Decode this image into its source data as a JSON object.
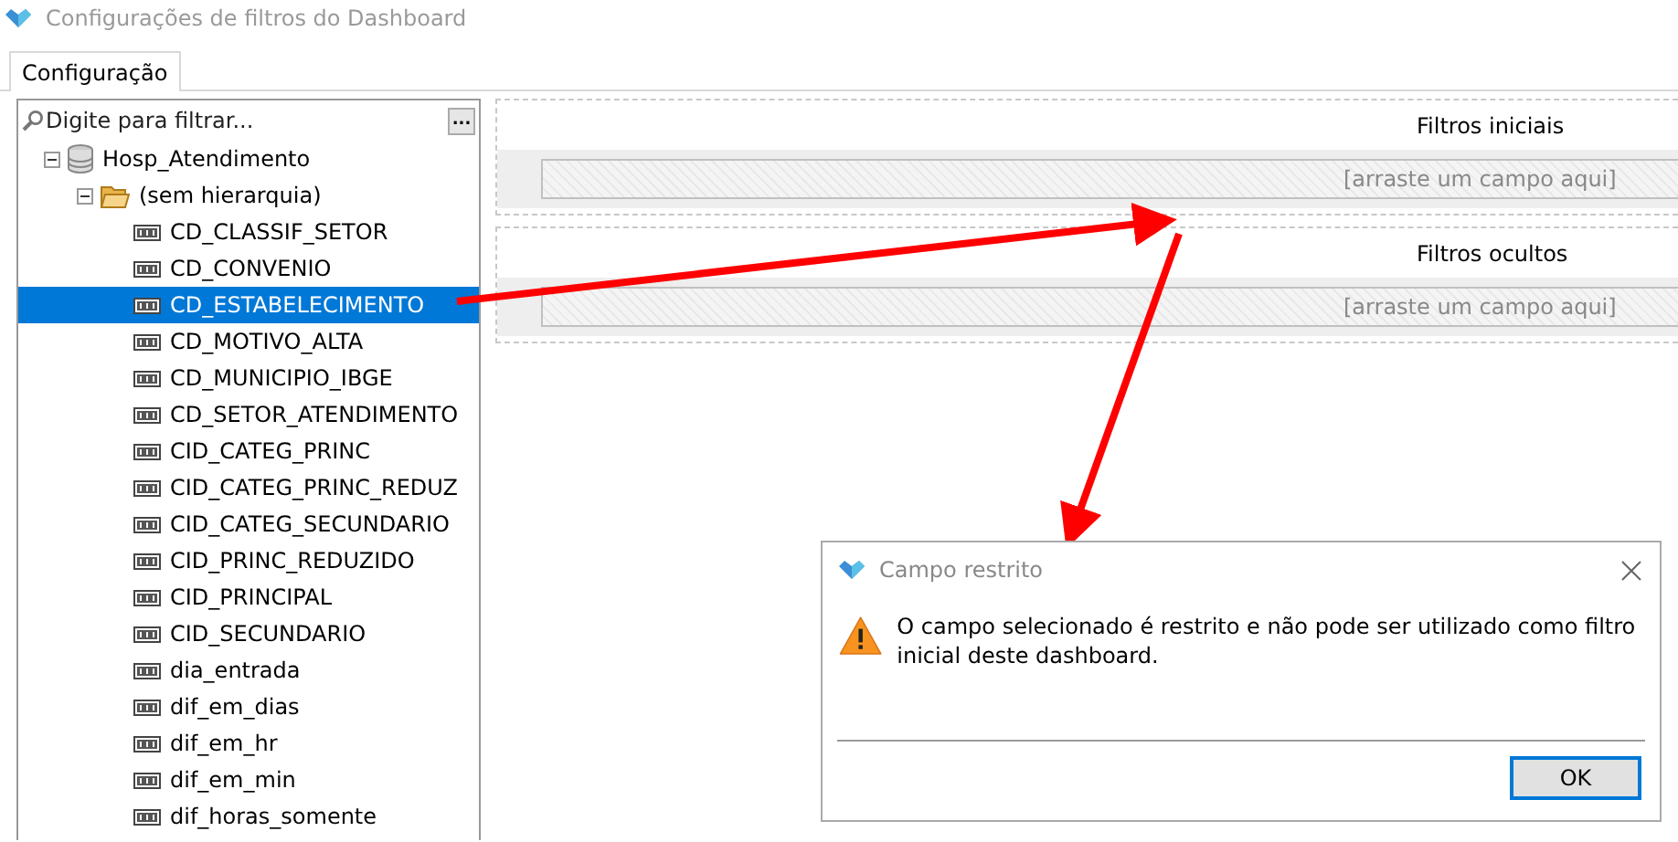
{
  "window": {
    "title": "Configurações de filtros do Dashboard"
  },
  "tabs": [
    {
      "label": "Configuração",
      "selected": true
    }
  ],
  "tree": {
    "search": {
      "placeholder": "Digite para filtrar...",
      "button": "..."
    },
    "nodes": [
      {
        "label": "Hosp_Atendimento",
        "kind": "database",
        "expanded": true,
        "selected": false,
        "children": [
          {
            "label": "(sem hierarquia)",
            "kind": "folder",
            "expanded": true,
            "selected": false,
            "children": [
              {
                "label": "CD_CLASSIF_SETOR",
                "kind": "field",
                "selected": false
              },
              {
                "label": "CD_CONVENIO",
                "kind": "field",
                "selected": false
              },
              {
                "label": "CD_ESTABELECIMENTO",
                "kind": "field",
                "selected": true
              },
              {
                "label": "CD_MOTIVO_ALTA",
                "kind": "field",
                "selected": false
              },
              {
                "label": "CD_MUNICIPIO_IBGE",
                "kind": "field",
                "selected": false
              },
              {
                "label": "CD_SETOR_ATENDIMENTO",
                "kind": "field",
                "selected": false
              },
              {
                "label": "CID_CATEG_PRINC",
                "kind": "field",
                "selected": false
              },
              {
                "label": "CID_CATEG_PRINC_REDUZ",
                "kind": "field",
                "selected": false
              },
              {
                "label": "CID_CATEG_SECUNDARIO",
                "kind": "field",
                "selected": false
              },
              {
                "label": "CID_PRINC_REDUZIDO",
                "kind": "field",
                "selected": false
              },
              {
                "label": "CID_PRINCIPAL",
                "kind": "field",
                "selected": false
              },
              {
                "label": "CID_SECUNDARIO",
                "kind": "field",
                "selected": false
              },
              {
                "label": "dia_entrada",
                "kind": "field",
                "selected": false
              },
              {
                "label": "dif_em_dias",
                "kind": "field",
                "selected": false
              },
              {
                "label": "dif_em_hr",
                "kind": "field",
                "selected": false
              },
              {
                "label": "dif_em_min",
                "kind": "field",
                "selected": false
              },
              {
                "label": "dif_horas_somente",
                "kind": "field",
                "selected": false
              }
            ]
          }
        ]
      }
    ]
  },
  "filter_sections": [
    {
      "title": "Filtros iniciais",
      "drop_hint": "[arraste um campo aqui]"
    },
    {
      "title": "Filtros ocultos",
      "drop_hint": "[arraste um campo aqui]"
    }
  ],
  "dialog": {
    "title": "Campo restrito",
    "message": "O campo selecionado é restrito e não pode ser utilizado como filtro inicial deste dashboard.",
    "button": "OK"
  }
}
